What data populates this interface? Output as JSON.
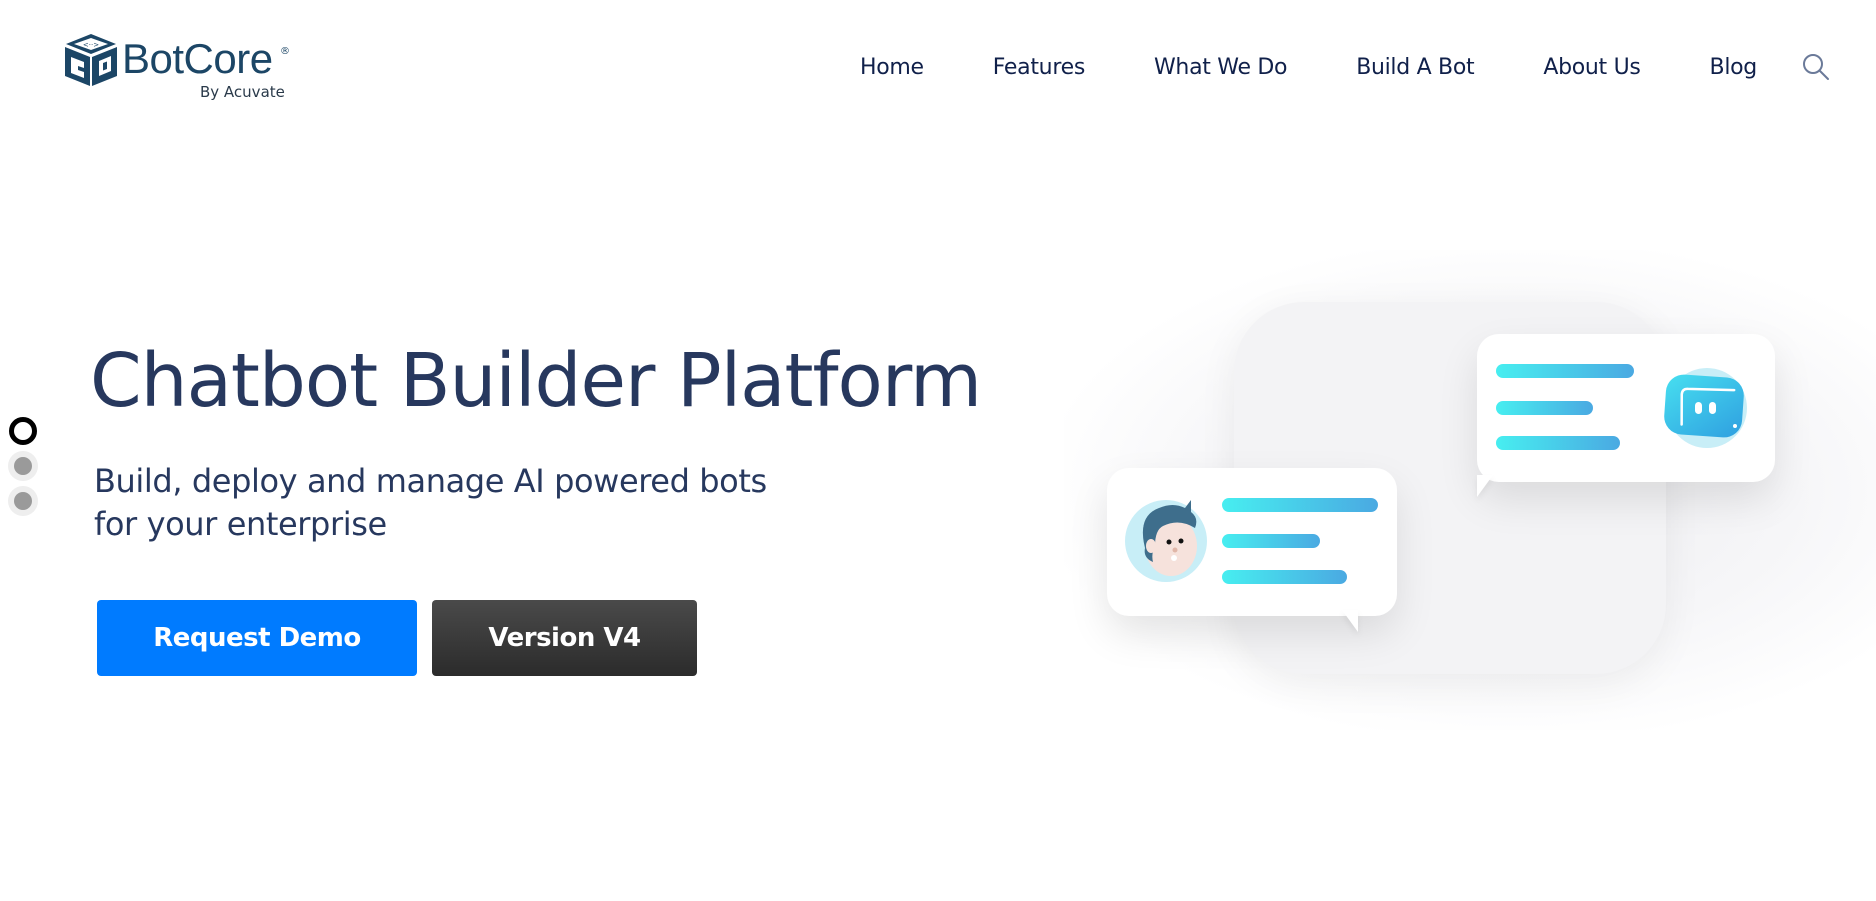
{
  "brand": {
    "name": "BotCore",
    "registered": "®",
    "tagline": "By Acuvate",
    "color": "#1c4666"
  },
  "nav": {
    "items": [
      {
        "label": "Home"
      },
      {
        "label": "Features"
      },
      {
        "label": "What We Do"
      },
      {
        "label": "Build A Bot"
      },
      {
        "label": "About Us"
      },
      {
        "label": "Blog"
      }
    ],
    "search_icon": "search-icon"
  },
  "slider": {
    "dots": 3,
    "active_index": 0
  },
  "hero": {
    "title": "Chatbot Builder Platform",
    "subtitle": "Build, deploy and manage AI powered bots for your enterprise",
    "primary_button": "Request Demo",
    "secondary_button": "Version V4",
    "colors": {
      "title": "#27385e",
      "primary": "#007bff",
      "secondary": "#3a3a3a"
    }
  },
  "illustration": {
    "description": "Chat illustration: user bubble and bot bubble",
    "line_gradient": [
      "#47eef0",
      "#4aa9e2"
    ]
  }
}
